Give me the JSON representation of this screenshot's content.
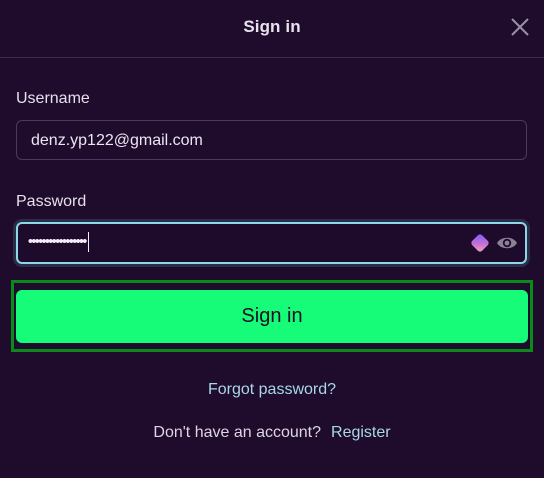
{
  "dialog": {
    "title": "Sign in",
    "close_icon": "close-icon"
  },
  "username": {
    "label": "Username",
    "value": "denz.yp122@gmail.com"
  },
  "password": {
    "label": "Password",
    "value": "•••••••••••••••••",
    "manager_icon": "password-manager-icon",
    "reveal_icon": "eye-icon"
  },
  "submit": {
    "label": "Sign in"
  },
  "links": {
    "forgot": "Forgot password?",
    "no_account": "Don't have an account?",
    "register": "Register"
  },
  "colors": {
    "background": "#1f0b2c",
    "accent_button": "#16fb78",
    "link": "#a8d8e8",
    "focus_outline": "#0b8a1c"
  }
}
